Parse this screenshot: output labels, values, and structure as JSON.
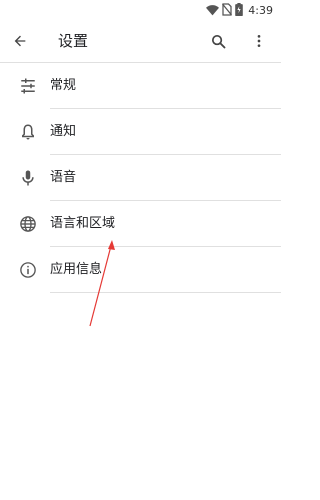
{
  "status_bar": {
    "time": "4:39",
    "icons": [
      "wifi-icon",
      "no-sim-icon",
      "battery-icon"
    ]
  },
  "app_bar": {
    "title": "设置",
    "back_icon": "arrow-back-icon",
    "search_icon": "search-icon",
    "more_icon": "more-vert-icon"
  },
  "settings": {
    "items": [
      {
        "label": "常规",
        "icon": "tune-icon"
      },
      {
        "label": "通知",
        "icon": "bell-icon"
      },
      {
        "label": "语音",
        "icon": "microphone-icon"
      },
      {
        "label": "语言和区域",
        "icon": "globe-icon"
      },
      {
        "label": "应用信息",
        "icon": "info-icon"
      }
    ]
  },
  "annotation": {
    "color": "#e53935",
    "points_to": "语言和区域"
  }
}
